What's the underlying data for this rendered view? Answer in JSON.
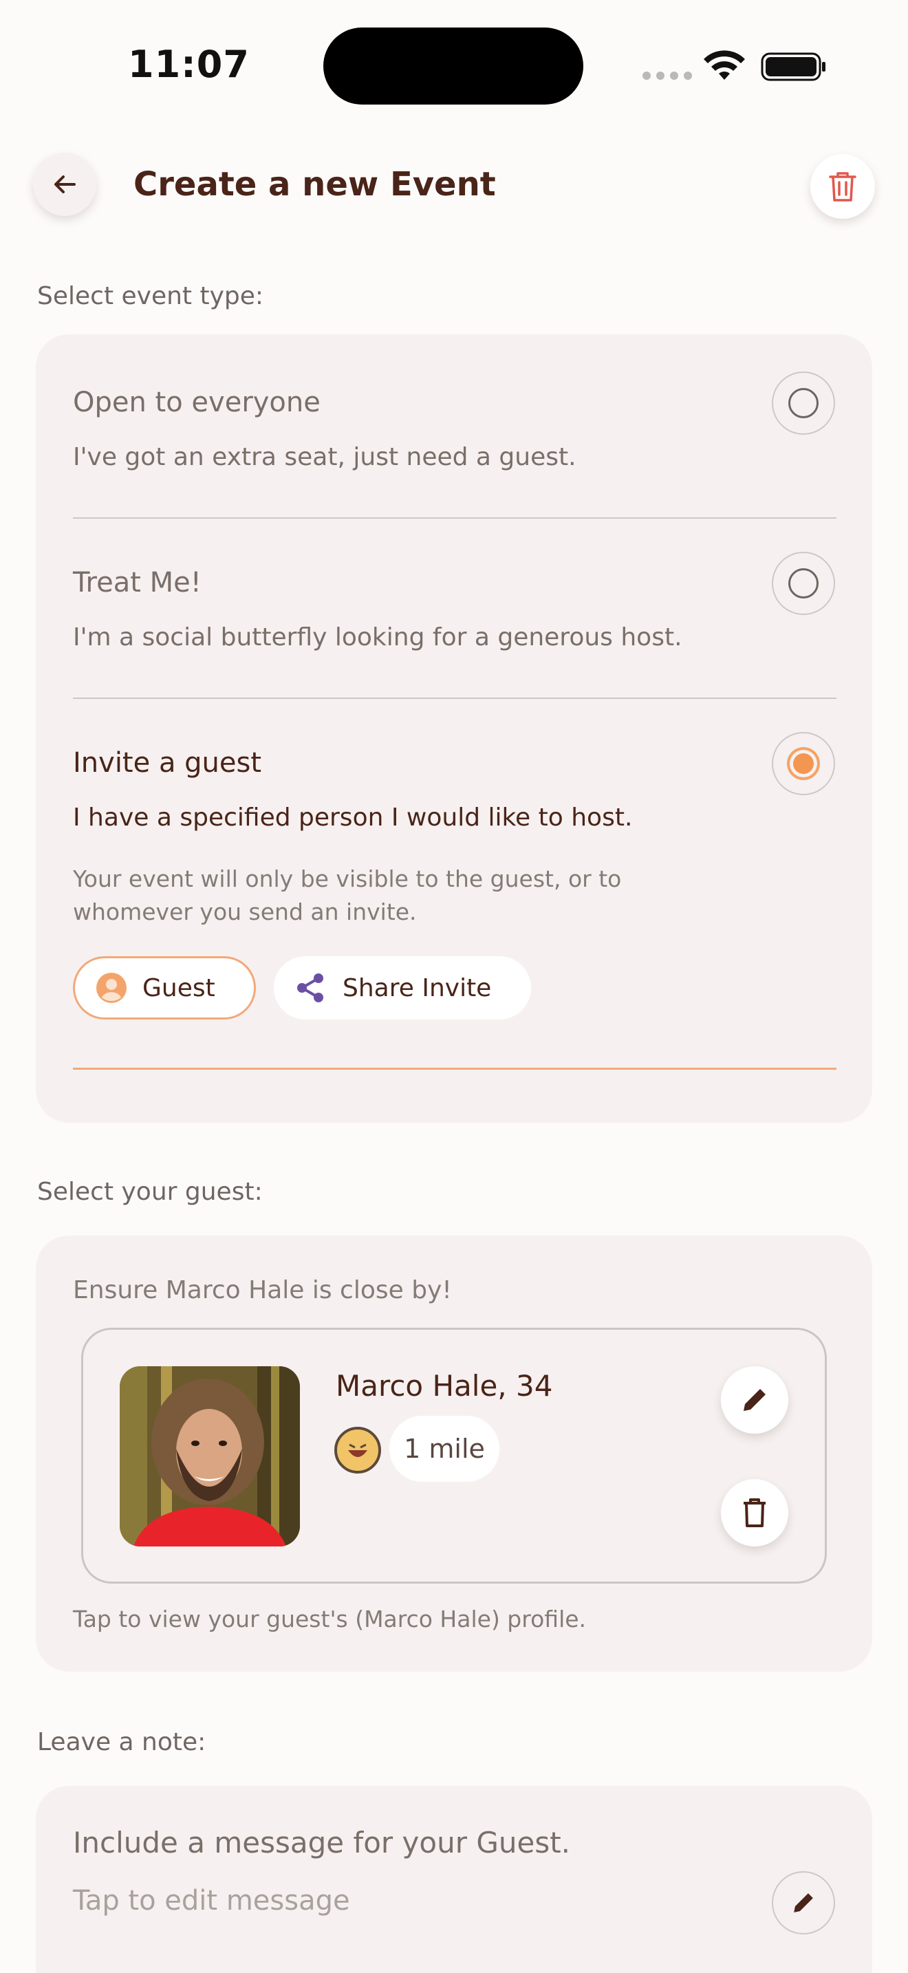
{
  "status_bar": {
    "time": "11:07"
  },
  "header": {
    "title": "Create a new Event"
  },
  "event_type": {
    "label": "Select event type:",
    "options": [
      {
        "title": "Open to everyone",
        "description": "I've got an extra seat, just need a guest.",
        "selected": false
      },
      {
        "title": "Treat Me!",
        "description": "I'm a social butterfly looking for a generous host.",
        "selected": false
      },
      {
        "title": "Invite a guest",
        "description": "I have a specified person I would like to host.",
        "selected": true
      }
    ],
    "visibility_note": "Your event will only be visible to the guest, or to whomever you send an invite.",
    "guest_chip": "Guest",
    "share_chip": "Share Invite"
  },
  "guest_section": {
    "label": "Select your guest:",
    "proximity_note": "Ensure Marco Hale is close by!",
    "guest_name": "Marco Hale, 34",
    "distance": "1 mile",
    "hint": "Tap to view your guest's (Marco Hale) profile."
  },
  "note_section": {
    "label": "Leave a note:",
    "heading": "Include a message for your Guest.",
    "placeholder": "Tap to edit message"
  },
  "colors": {
    "accent": "#f29651",
    "title": "#4a2418",
    "card": "#f6f1f0",
    "delete": "#e2574c",
    "share_icon": "#6b4fa3"
  }
}
